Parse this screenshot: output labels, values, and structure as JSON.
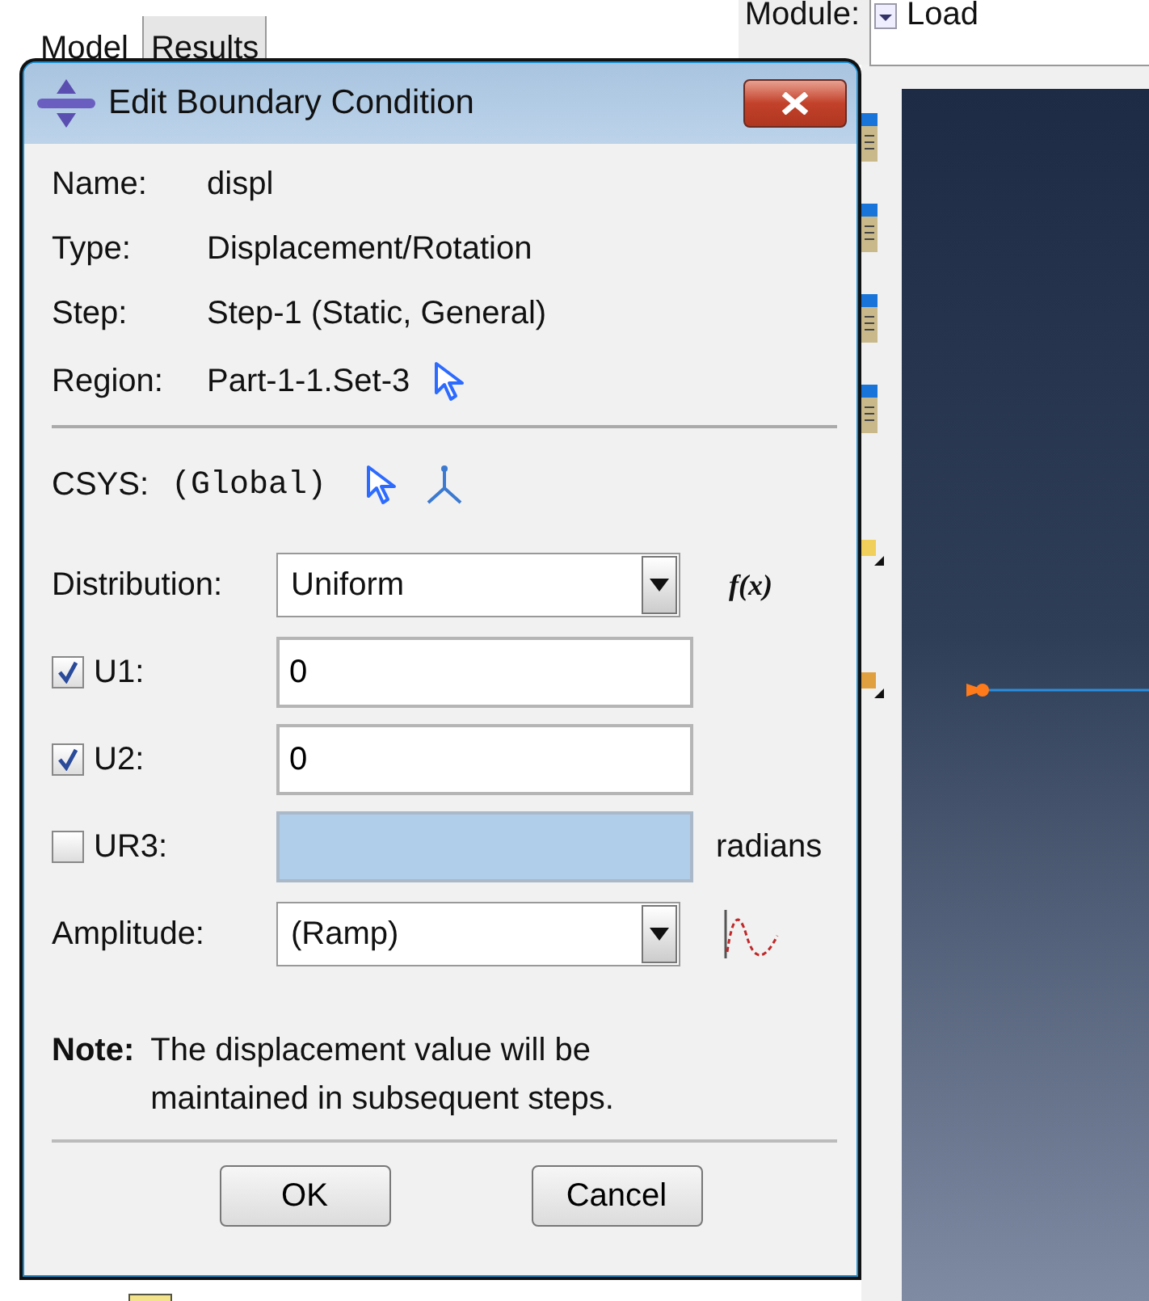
{
  "tabs": [
    {
      "label": "Model",
      "selected": true
    },
    {
      "label": "Results",
      "selected": false
    }
  ],
  "module": {
    "label": "Module:",
    "value": "Load"
  },
  "dialog": {
    "title": "Edit Boundary Condition",
    "info": [
      {
        "label": "Name:",
        "value": "displ",
        "kind": "text"
      },
      {
        "label": "Type:",
        "value": "Displacement/Rotation",
        "kind": "text"
      },
      {
        "label": "Step:",
        "value": "Step-1 (Static, General)",
        "kind": "text"
      },
      {
        "label": "Region:",
        "value": "Part-1-1.Set-3",
        "kind": "pick"
      }
    ],
    "csys": {
      "label": "CSYS:",
      "value": "(Global)"
    },
    "distribution": {
      "label": "Distribution:",
      "value": "Uniform",
      "function": "f(x)"
    },
    "dofs": [
      {
        "label": "U1:",
        "checked": true,
        "value": "0"
      },
      {
        "label": "U2:",
        "checked": true,
        "value": "0"
      },
      {
        "label": "UR3:",
        "checked": false,
        "unit": "radians"
      }
    ],
    "amplitude": {
      "label": "Amplitude:",
      "value": "(Ramp)"
    },
    "note": {
      "label": "Note:",
      "text": "The displacement value will be maintained in subsequent steps."
    },
    "buttons": [
      "OK",
      "Cancel"
    ]
  }
}
